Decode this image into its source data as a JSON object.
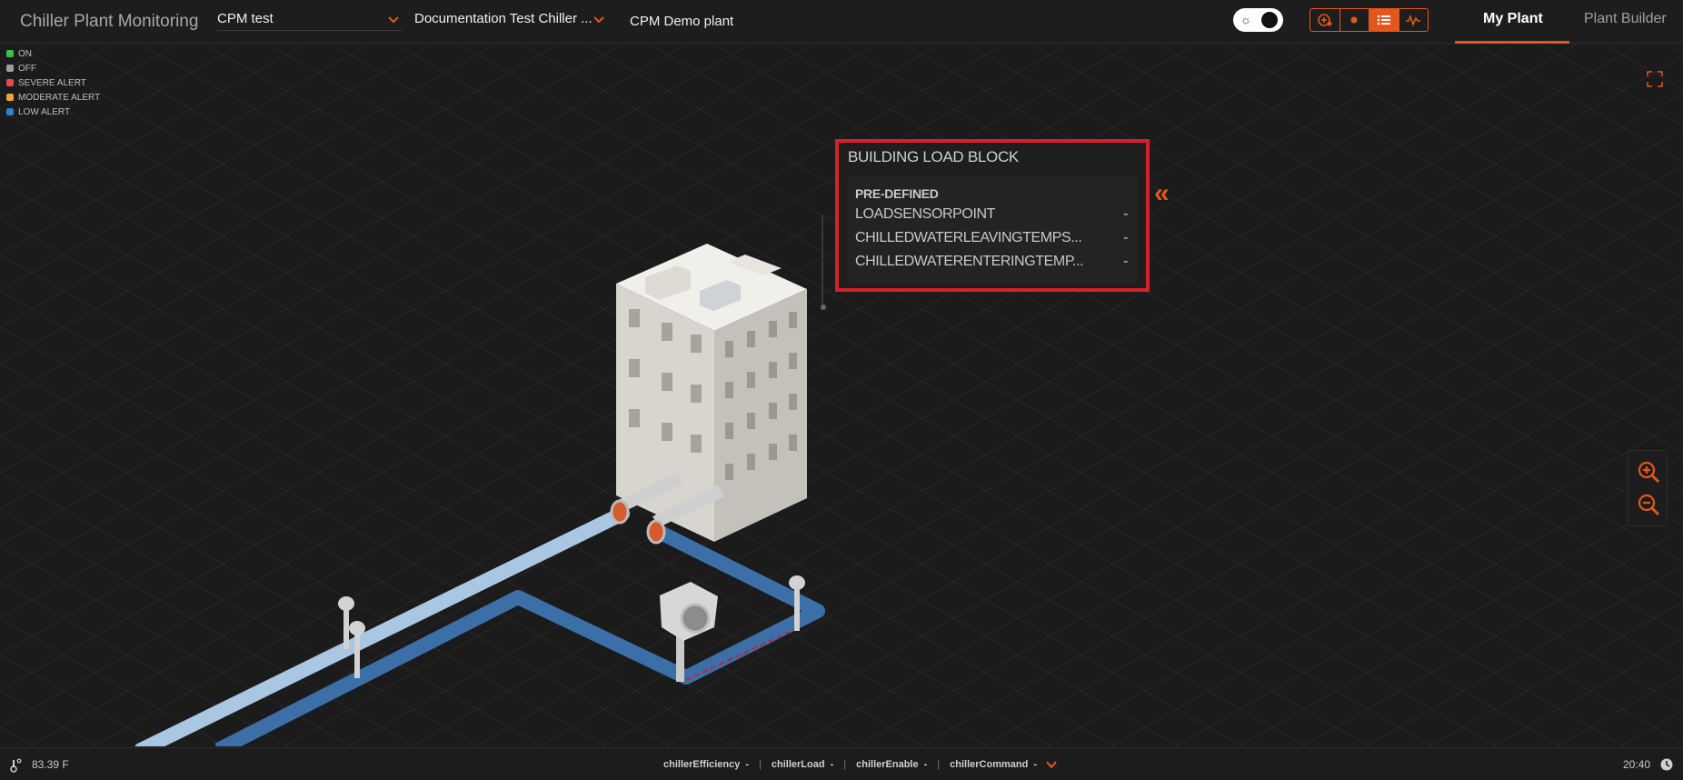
{
  "header": {
    "app_title": "Chiller Plant Monitoring",
    "project": "CPM test",
    "plant_doc": "Documentation Test Chiller ...",
    "plant_name": "CPM Demo plant",
    "tabs": [
      {
        "label": "My Plant",
        "active": true
      },
      {
        "label": "Plant Builder",
        "active": false
      }
    ],
    "accent_color": "#e4561a"
  },
  "legend": [
    {
      "label": "ON",
      "color": "#3fbf4f"
    },
    {
      "label": "OFF",
      "color": "#9e9e9e"
    },
    {
      "label": "SEVERE ALERT",
      "color": "#e5484d"
    },
    {
      "label": "MODERATE ALERT",
      "color": "#f0a33a"
    },
    {
      "label": "LOW ALERT",
      "color": "#2f7fcf"
    }
  ],
  "popup": {
    "title": "BUILDING LOAD BLOCK",
    "section": "PRE-DEFINED",
    "rows": [
      {
        "label": "LOADSENSORPOINT",
        "value": "-"
      },
      {
        "label": "CHILLEDWATERLEAVINGTEMPS...",
        "value": "-"
      },
      {
        "label": "CHILLEDWATERENTERINGTEMP...",
        "value": "-"
      }
    ],
    "border_color": "#d8202b"
  },
  "status": {
    "temperature": "83.39 F",
    "metrics": [
      {
        "label": "chillerEfficiency",
        "value": "-"
      },
      {
        "label": "chillerLoad",
        "value": "-"
      },
      {
        "label": "chillerEnable",
        "value": "-"
      },
      {
        "label": "chillerCommand",
        "value": "-"
      }
    ],
    "time": "20:40"
  },
  "icons": {
    "view_buttons": [
      "plant-view-icon",
      "dot-icon",
      "list-icon",
      "trend-icon"
    ],
    "theme_toggle": "sun-icon",
    "zoom_in": "zoom-in-icon",
    "zoom_out": "zoom-out-icon",
    "fullscreen": "expand-icon",
    "collapse": "double-chevron-left-icon"
  }
}
